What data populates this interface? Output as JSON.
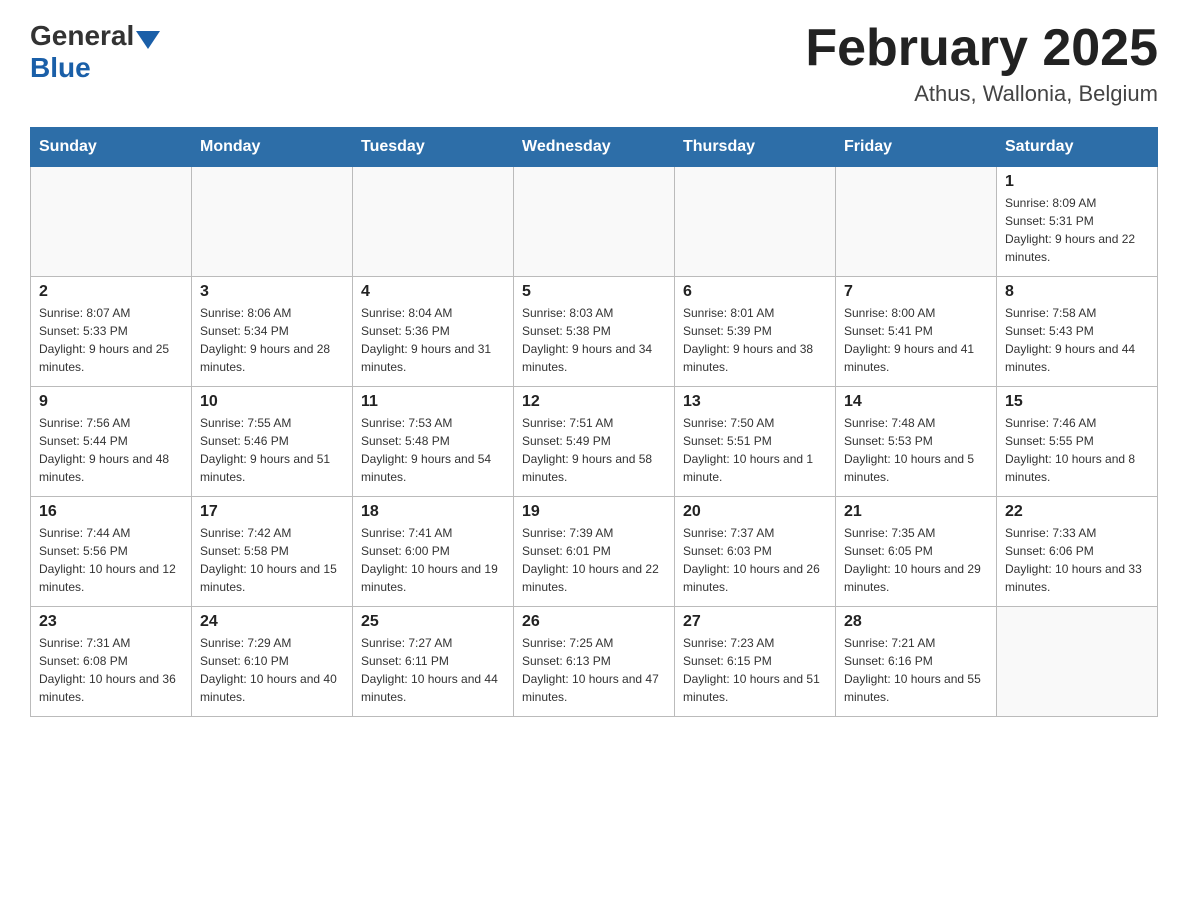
{
  "header": {
    "logo_general": "General",
    "logo_blue": "Blue",
    "month_title": "February 2025",
    "location": "Athus, Wallonia, Belgium"
  },
  "days_of_week": [
    "Sunday",
    "Monday",
    "Tuesday",
    "Wednesday",
    "Thursday",
    "Friday",
    "Saturday"
  ],
  "weeks": [
    [
      {
        "day": "",
        "sunrise": "",
        "sunset": "",
        "daylight": ""
      },
      {
        "day": "",
        "sunrise": "",
        "sunset": "",
        "daylight": ""
      },
      {
        "day": "",
        "sunrise": "",
        "sunset": "",
        "daylight": ""
      },
      {
        "day": "",
        "sunrise": "",
        "sunset": "",
        "daylight": ""
      },
      {
        "day": "",
        "sunrise": "",
        "sunset": "",
        "daylight": ""
      },
      {
        "day": "",
        "sunrise": "",
        "sunset": "",
        "daylight": ""
      },
      {
        "day": "1",
        "sunrise": "Sunrise: 8:09 AM",
        "sunset": "Sunset: 5:31 PM",
        "daylight": "Daylight: 9 hours and 22 minutes."
      }
    ],
    [
      {
        "day": "2",
        "sunrise": "Sunrise: 8:07 AM",
        "sunset": "Sunset: 5:33 PM",
        "daylight": "Daylight: 9 hours and 25 minutes."
      },
      {
        "day": "3",
        "sunrise": "Sunrise: 8:06 AM",
        "sunset": "Sunset: 5:34 PM",
        "daylight": "Daylight: 9 hours and 28 minutes."
      },
      {
        "day": "4",
        "sunrise": "Sunrise: 8:04 AM",
        "sunset": "Sunset: 5:36 PM",
        "daylight": "Daylight: 9 hours and 31 minutes."
      },
      {
        "day": "5",
        "sunrise": "Sunrise: 8:03 AM",
        "sunset": "Sunset: 5:38 PM",
        "daylight": "Daylight: 9 hours and 34 minutes."
      },
      {
        "day": "6",
        "sunrise": "Sunrise: 8:01 AM",
        "sunset": "Sunset: 5:39 PM",
        "daylight": "Daylight: 9 hours and 38 minutes."
      },
      {
        "day": "7",
        "sunrise": "Sunrise: 8:00 AM",
        "sunset": "Sunset: 5:41 PM",
        "daylight": "Daylight: 9 hours and 41 minutes."
      },
      {
        "day": "8",
        "sunrise": "Sunrise: 7:58 AM",
        "sunset": "Sunset: 5:43 PM",
        "daylight": "Daylight: 9 hours and 44 minutes."
      }
    ],
    [
      {
        "day": "9",
        "sunrise": "Sunrise: 7:56 AM",
        "sunset": "Sunset: 5:44 PM",
        "daylight": "Daylight: 9 hours and 48 minutes."
      },
      {
        "day": "10",
        "sunrise": "Sunrise: 7:55 AM",
        "sunset": "Sunset: 5:46 PM",
        "daylight": "Daylight: 9 hours and 51 minutes."
      },
      {
        "day": "11",
        "sunrise": "Sunrise: 7:53 AM",
        "sunset": "Sunset: 5:48 PM",
        "daylight": "Daylight: 9 hours and 54 minutes."
      },
      {
        "day": "12",
        "sunrise": "Sunrise: 7:51 AM",
        "sunset": "Sunset: 5:49 PM",
        "daylight": "Daylight: 9 hours and 58 minutes."
      },
      {
        "day": "13",
        "sunrise": "Sunrise: 7:50 AM",
        "sunset": "Sunset: 5:51 PM",
        "daylight": "Daylight: 10 hours and 1 minute."
      },
      {
        "day": "14",
        "sunrise": "Sunrise: 7:48 AM",
        "sunset": "Sunset: 5:53 PM",
        "daylight": "Daylight: 10 hours and 5 minutes."
      },
      {
        "day": "15",
        "sunrise": "Sunrise: 7:46 AM",
        "sunset": "Sunset: 5:55 PM",
        "daylight": "Daylight: 10 hours and 8 minutes."
      }
    ],
    [
      {
        "day": "16",
        "sunrise": "Sunrise: 7:44 AM",
        "sunset": "Sunset: 5:56 PM",
        "daylight": "Daylight: 10 hours and 12 minutes."
      },
      {
        "day": "17",
        "sunrise": "Sunrise: 7:42 AM",
        "sunset": "Sunset: 5:58 PM",
        "daylight": "Daylight: 10 hours and 15 minutes."
      },
      {
        "day": "18",
        "sunrise": "Sunrise: 7:41 AM",
        "sunset": "Sunset: 6:00 PM",
        "daylight": "Daylight: 10 hours and 19 minutes."
      },
      {
        "day": "19",
        "sunrise": "Sunrise: 7:39 AM",
        "sunset": "Sunset: 6:01 PM",
        "daylight": "Daylight: 10 hours and 22 minutes."
      },
      {
        "day": "20",
        "sunrise": "Sunrise: 7:37 AM",
        "sunset": "Sunset: 6:03 PM",
        "daylight": "Daylight: 10 hours and 26 minutes."
      },
      {
        "day": "21",
        "sunrise": "Sunrise: 7:35 AM",
        "sunset": "Sunset: 6:05 PM",
        "daylight": "Daylight: 10 hours and 29 minutes."
      },
      {
        "day": "22",
        "sunrise": "Sunrise: 7:33 AM",
        "sunset": "Sunset: 6:06 PM",
        "daylight": "Daylight: 10 hours and 33 minutes."
      }
    ],
    [
      {
        "day": "23",
        "sunrise": "Sunrise: 7:31 AM",
        "sunset": "Sunset: 6:08 PM",
        "daylight": "Daylight: 10 hours and 36 minutes."
      },
      {
        "day": "24",
        "sunrise": "Sunrise: 7:29 AM",
        "sunset": "Sunset: 6:10 PM",
        "daylight": "Daylight: 10 hours and 40 minutes."
      },
      {
        "day": "25",
        "sunrise": "Sunrise: 7:27 AM",
        "sunset": "Sunset: 6:11 PM",
        "daylight": "Daylight: 10 hours and 44 minutes."
      },
      {
        "day": "26",
        "sunrise": "Sunrise: 7:25 AM",
        "sunset": "Sunset: 6:13 PM",
        "daylight": "Daylight: 10 hours and 47 minutes."
      },
      {
        "day": "27",
        "sunrise": "Sunrise: 7:23 AM",
        "sunset": "Sunset: 6:15 PM",
        "daylight": "Daylight: 10 hours and 51 minutes."
      },
      {
        "day": "28",
        "sunrise": "Sunrise: 7:21 AM",
        "sunset": "Sunset: 6:16 PM",
        "daylight": "Daylight: 10 hours and 55 minutes."
      },
      {
        "day": "",
        "sunrise": "",
        "sunset": "",
        "daylight": ""
      }
    ]
  ]
}
